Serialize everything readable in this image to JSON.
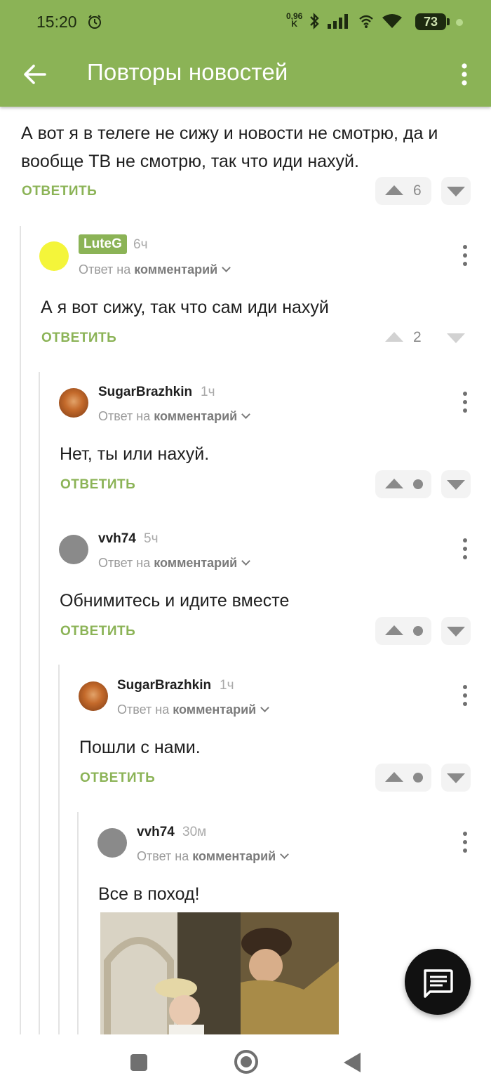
{
  "status_bar": {
    "time": "15:20",
    "net_speed_value": "0,96",
    "net_speed_unit": "K",
    "battery": "73"
  },
  "app_bar": {
    "title": "Повторы новостей"
  },
  "comments": [
    {
      "text": "А вот я в телеге не сижу и новости не смотрю, да и вообще ТВ не смотрю, так что иди нахуй.",
      "reply_label": "ОТВЕТИТЬ",
      "rating": "6"
    },
    {
      "author": "LuteG",
      "time": "6ч",
      "reply_to_prefix": "Ответ на",
      "reply_to_target": "комментарий",
      "text": "А я вот сижу, так что сам иди нахуй",
      "reply_label": "ОТВЕТИТЬ",
      "rating": "2"
    },
    {
      "author": "SugarBrazhkin",
      "time": "1ч",
      "reply_to_prefix": "Ответ на",
      "reply_to_target": "комментарий",
      "text": "Нет, ты или нахуй.",
      "reply_label": "ОТВЕТИТЬ"
    },
    {
      "author": "vvh74",
      "time": "5ч",
      "reply_to_prefix": "Ответ на",
      "reply_to_target": "комментарий",
      "text": "Обнимитесь и идите вместе",
      "reply_label": "ОТВЕТИТЬ"
    },
    {
      "author": "SugarBrazhkin",
      "time": "1ч",
      "reply_to_prefix": "Ответ на",
      "reply_to_target": "комментарий",
      "text": "Пошли с нами.",
      "reply_label": "ОТВЕТИТЬ"
    },
    {
      "author": "vvh74",
      "time": "30м",
      "reply_to_prefix": "Ответ на",
      "reply_to_target": "комментарий",
      "text": "Все в поход!"
    }
  ],
  "colors": {
    "accent": "#8bb356",
    "fab": "#111111"
  }
}
